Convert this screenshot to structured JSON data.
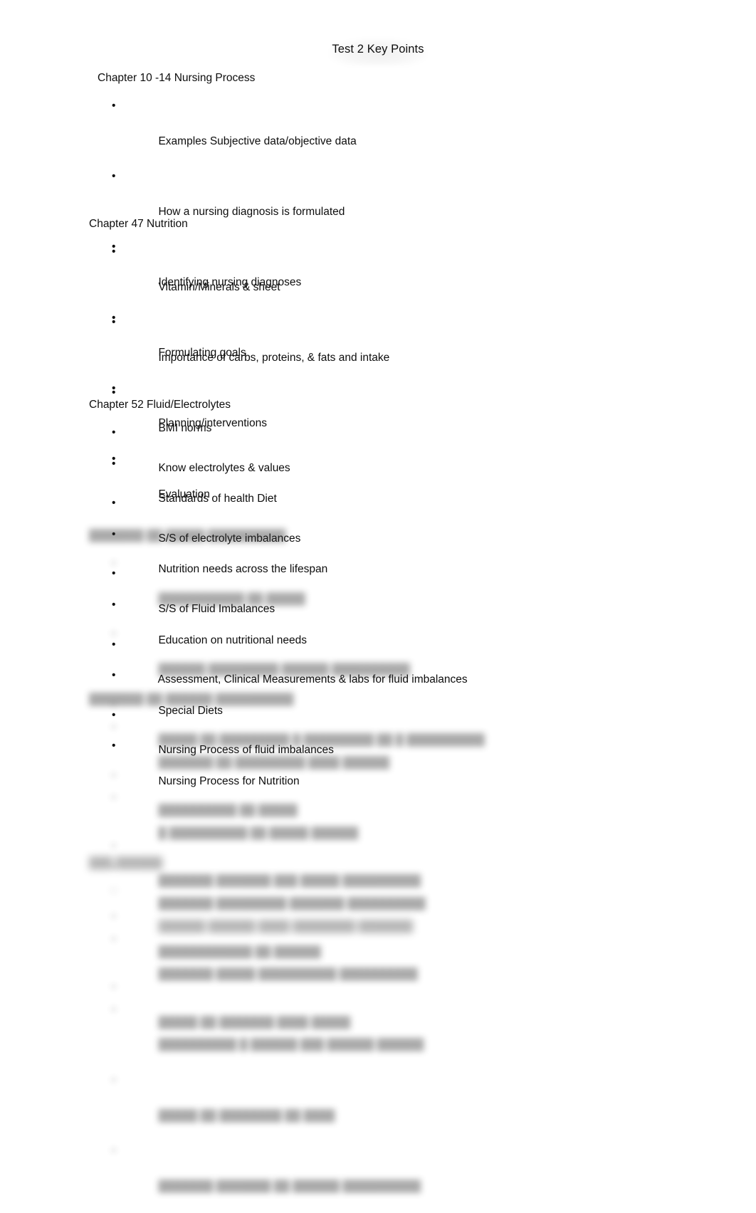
{
  "document": {
    "title": "Test 2 Key Points",
    "page_background": "#ffffff",
    "text_color": "#0d0d0d"
  },
  "sections": [
    {
      "heading": "Chapter 10 -14 Nursing Process",
      "redacted": false,
      "bullets": [
        "Examples Subjective data/objective data",
        "How a nursing diagnosis is formulated",
        "Identifying nursing diagnoses",
        "Formulating goals",
        "Planning/interventions",
        "Evaluation"
      ]
    },
    {
      "heading": "Chapter 47 Nutrition",
      "redacted": false,
      "bullets": [
        "Vitamin/Minerals & sheet",
        "Importance of carbs, proteins, & fats and intake",
        "BMI norms",
        "Standards of health Diet",
        "Nutrition needs across the lifespan",
        "Education on nutritional needs",
        "Special Diets",
        "Nursing Process for Nutrition"
      ]
    },
    {
      "heading": "Chapter 52 Fluid/Electrolytes",
      "redacted": false,
      "bullets": [
        "Know electrolytes & values",
        "S/S of electrolyte imbalances",
        "S/S of Fluid Imbalances",
        "Assessment, Clinical Measurements & labs for fluid imbalances",
        "Nursing Process of fluid imbalances"
      ]
    },
    {
      "heading": "███████ ██ █████ ██████████",
      "redacted": true,
      "bullets": [
        "███████████ ██ █████",
        "██████ █████████ ██████ ██████████",
        "█████ ██ █████████ █ █████████ ██ █ ██████████",
        "██████████ ██ █████",
        "███████ ███████ ███ █████ ██████████",
        "████████████ ██ ██████",
        "█████ ██ ███████ ████ █████"
      ]
    },
    {
      "heading": "███████ ██ ██████ ██████████",
      "redacted": true,
      "bullets": [
        "███████ ██ █████████ ████ ██████",
        "█ ██████████ ██ █████ ██████",
        "███████ █████████ ███████ ██████████",
        "███████ █████ ██████████ ██████████",
        "██████████ █ ██████ ███ ██████ ██████",
        "█████ ██ ████████ ██ ████",
        "███████ ███████ ██ ██████ ██████████"
      ]
    },
    {
      "heading": "███ ██████",
      "redacted": true,
      "bullets": [
        "██████ ██████ ████ ████████ ███████"
      ]
    }
  ],
  "icons": {
    "bullet_glyph": "•"
  }
}
